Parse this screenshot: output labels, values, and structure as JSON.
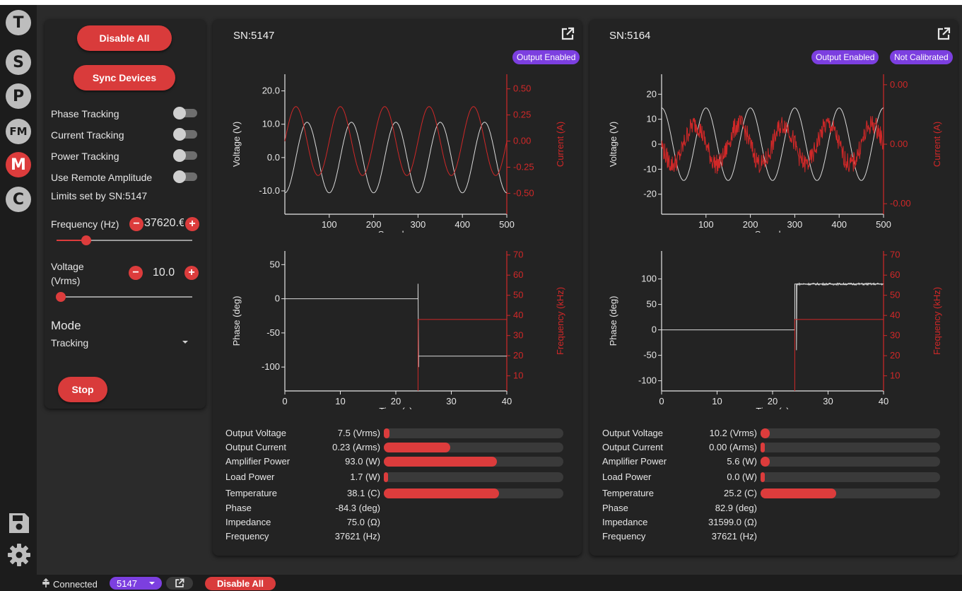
{
  "rail": {
    "buttons": [
      "T",
      "S",
      "P",
      "FM",
      "M",
      "C"
    ],
    "active": "M",
    "bottom_icons": [
      "save-icon",
      "gear-icon"
    ]
  },
  "colors": {
    "accent": "#dc3c3c",
    "badge": "#7c3fe0",
    "panel": "#232323",
    "background": "#2b2b2b"
  },
  "control": {
    "disable_all": "Disable All",
    "sync_devices": "Sync Devices",
    "toggles": [
      "Phase Tracking",
      "Current Tracking",
      "Power Tracking",
      "Use Remote Amplitude"
    ],
    "limits_text": "Limits set by SN:5147",
    "frequency": {
      "label": "Frequency (Hz)",
      "value": "37620.€",
      "slider_fraction": 0.22
    },
    "voltage": {
      "label_line1": "Voltage",
      "label_line2": "(Vrms)",
      "value": "10.0",
      "slider_fraction": 0.03
    },
    "mode": {
      "label": "Mode",
      "value": "Tracking"
    },
    "stop": "Stop"
  },
  "devices": [
    {
      "sn": "SN:5147",
      "badges": [
        "Output Enabled"
      ],
      "metrics": [
        {
          "name": "Output Voltage",
          "value": "7.5 (Vrms)",
          "fraction": 0.03
        },
        {
          "name": "Output Current",
          "value": "0.23 (Arms)",
          "fraction": 0.37
        },
        {
          "name": "Amplifier Power",
          "value": "93.0 (W)",
          "fraction": 0.63
        },
        {
          "name": "Load Power",
          "value": "1.7 (W)",
          "fraction": 0.02
        },
        {
          "name": "Temperature",
          "value": "38.1 (C)",
          "fraction": 0.64
        },
        {
          "name": "Phase",
          "value": "-84.3 (deg)"
        },
        {
          "name": "Impedance",
          "value": "75.0 (Ω)"
        },
        {
          "name": "Frequency",
          "value": "37621 (Hz)"
        }
      ]
    },
    {
      "sn": "SN:5164",
      "badges": [
        "Output Enabled",
        "Not Calibrated"
      ],
      "metrics": [
        {
          "name": "Output Voltage",
          "value": "10.2 (Vrms)",
          "fraction": 0.05
        },
        {
          "name": "Output Current",
          "value": "0.00 (Arms)",
          "fraction": 0.01
        },
        {
          "name": "Amplifier Power",
          "value": "5.6 (W)",
          "fraction": 0.05
        },
        {
          "name": "Load Power",
          "value": "0.0 (W)",
          "fraction": 0.01
        },
        {
          "name": "Temperature",
          "value": "25.2 (C)",
          "fraction": 0.42
        },
        {
          "name": "Phase",
          "value": "82.9 (deg)"
        },
        {
          "name": "Impedance",
          "value": "31599.0 (Ω)"
        },
        {
          "name": "Frequency",
          "value": "37621 (Hz)"
        }
      ]
    }
  ],
  "chart_data": [
    {
      "type": "line",
      "device": "SN:5147",
      "xlabel": "Samples",
      "ylabel": "Voltage (V)",
      "y2label": "Current (A)",
      "xlim": [
        0,
        500
      ],
      "ylim": [
        -17,
        25
      ],
      "y2lim": [
        -0.7,
        0.64
      ],
      "xticks": [
        "100",
        "200",
        "300",
        "400",
        "500"
      ],
      "yticks": [
        "20.0",
        "10.0",
        "0.0",
        "-10.0"
      ],
      "y2ticks": [
        "0.50",
        "0.25",
        "0.00",
        "-0.25",
        "-0.50"
      ],
      "series": [
        {
          "color": "#d9d9d9",
          "axis": "left",
          "shape": "sine",
          "amplitude": 10.6,
          "period": 100,
          "phase_deg": -90,
          "noise": 0
        },
        {
          "color": "#d02828",
          "axis": "right",
          "shape": "sine",
          "amplitude": 0.33,
          "period": 100,
          "phase_deg": 0,
          "noise": 0
        }
      ]
    },
    {
      "type": "line",
      "device": "SN:5147",
      "xlabel": "Time (s)",
      "ylabel": "Phase (deg)",
      "y2label": "Frequency (kHz)",
      "xlim": [
        0,
        40
      ],
      "ylim": [
        -135,
        70
      ],
      "y2lim": [
        2.5,
        72
      ],
      "xticks": [
        "0",
        "10",
        "20",
        "30",
        "40"
      ],
      "yticks": [
        "50",
        "0",
        "-50",
        "-100"
      ],
      "y2ticks": [
        "70",
        "60",
        "50",
        "40",
        "30",
        "20",
        "10"
      ],
      "series": [
        {
          "color": "#d9d9d9",
          "axis": "left",
          "shape": "steps",
          "points": [
            [
              0,
              0
            ],
            [
              24,
              0
            ],
            [
              24,
              22
            ],
            [
              24.1,
              -100
            ],
            [
              24.1,
              -84
            ],
            [
              40,
              -84
            ]
          ]
        },
        {
          "color": "#d02828",
          "axis": "right",
          "shape": "steps",
          "points": [
            [
              24,
              2.5
            ],
            [
              24,
              38
            ],
            [
              40,
              38
            ]
          ]
        }
      ]
    },
    {
      "type": "line",
      "device": "SN:5164",
      "xlabel": "Samples",
      "ylabel": "Voltage (V)",
      "y2label": "Current (A)",
      "xlim": [
        0,
        500
      ],
      "ylim": [
        -28,
        28
      ],
      "y2lim": [
        -0.01,
        0.01
      ],
      "xticks": [
        "100",
        "200",
        "300",
        "400",
        "500"
      ],
      "yticks": [
        "20",
        "10",
        "0",
        "-10",
        "-20"
      ],
      "y2ticks": [
        "0.00",
        "0.00",
        "-0.00"
      ],
      "series": [
        {
          "color": "#d9d9d9",
          "axis": "left",
          "shape": "sine",
          "amplitude": 14.5,
          "period": 100,
          "phase_deg": 90,
          "noise": 0
        },
        {
          "color": "#d02828",
          "axis": "left",
          "shape": "sine",
          "amplitude": 8,
          "period": 100,
          "phase_deg": 180,
          "noise": 4
        }
      ]
    },
    {
      "type": "line",
      "device": "SN:5164",
      "xlabel": "Time (s)",
      "ylabel": "Phase (deg)",
      "y2label": "Frequency (kHz)",
      "xlim": [
        0,
        40
      ],
      "ylim": [
        -120,
        155
      ],
      "y2lim": [
        2.5,
        72
      ],
      "xticks": [
        "0",
        "10",
        "20",
        "30",
        "40"
      ],
      "yticks": [
        "100",
        "50",
        "0",
        "-50",
        "-100"
      ],
      "y2ticks": [
        "70",
        "60",
        "50",
        "40",
        "30",
        "20",
        "10"
      ],
      "series": [
        {
          "color": "#d9d9d9",
          "axis": "left",
          "shape": "steps",
          "points": [
            [
              0,
              0
            ],
            [
              24,
              0
            ],
            [
              24,
              90
            ],
            [
              24.3,
              90
            ],
            [
              24.3,
              -40
            ],
            [
              24.4,
              90
            ],
            [
              40,
              90
            ]
          ],
          "noise": 2
        },
        {
          "color": "#d02828",
          "axis": "right",
          "shape": "steps",
          "points": [
            [
              24,
              2.5
            ],
            [
              24,
              38
            ],
            [
              40,
              38
            ]
          ]
        }
      ]
    }
  ],
  "footer": {
    "connected": "Connected",
    "device": "5147",
    "disable_all": "Disable All"
  }
}
